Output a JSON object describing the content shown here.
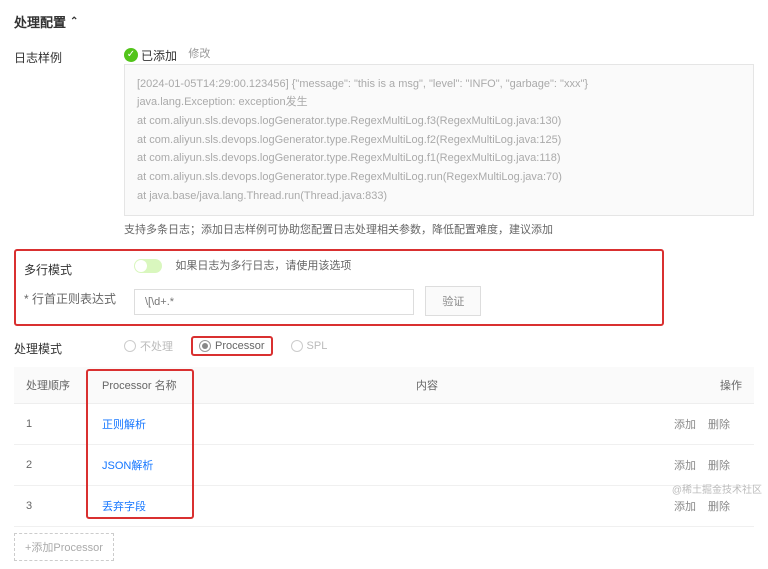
{
  "section_title": "处理配置",
  "log_sample": {
    "label": "日志样例",
    "status": "已添加",
    "modify": "修改",
    "lines": [
      "[2024-01-05T14:29:00.123456] {\"message\": \"this is a msg\", \"level\": \"INFO\", \"garbage\": \"xxx\"}",
      "java.lang.Exception: exception发生",
      "    at com.aliyun.sls.devops.logGenerator.type.RegexMultiLog.f3(RegexMultiLog.java:130)",
      "    at com.aliyun.sls.devops.logGenerator.type.RegexMultiLog.f2(RegexMultiLog.java:125)",
      "    at com.aliyun.sls.devops.logGenerator.type.RegexMultiLog.f1(RegexMultiLog.java:118)",
      "    at com.aliyun.sls.devops.logGenerator.type.RegexMultiLog.run(RegexMultiLog.java:70)",
      "    at java.base/java.lang.Thread.run(Thread.java:833)"
    ],
    "hint": "支持多条日志；添加日志样例可协助您配置日志处理相关参数，降低配置难度，建议添加"
  },
  "multiline": {
    "label": "多行模式",
    "desc": "如果日志为多行日志，请使用该选项",
    "regex_label": "行首正则表达式",
    "regex_placeholder": "\\[\\d+.*",
    "verify": "验证"
  },
  "mode": {
    "label": "处理模式",
    "options": [
      "不处理",
      "Processor",
      "SPL"
    ]
  },
  "table": {
    "headers": {
      "order": "处理顺序",
      "name": "Processor 名称",
      "content": "内容",
      "ops": "操作"
    },
    "rows": [
      {
        "order": "1",
        "name": "正则解析"
      },
      {
        "order": "2",
        "name": "JSON解析"
      },
      {
        "order": "3",
        "name": "丢弃字段"
      }
    ],
    "add": "添加",
    "del": "删除"
  },
  "add_processor": "+添加Processor",
  "watermark": "@稀土掘金技术社区"
}
